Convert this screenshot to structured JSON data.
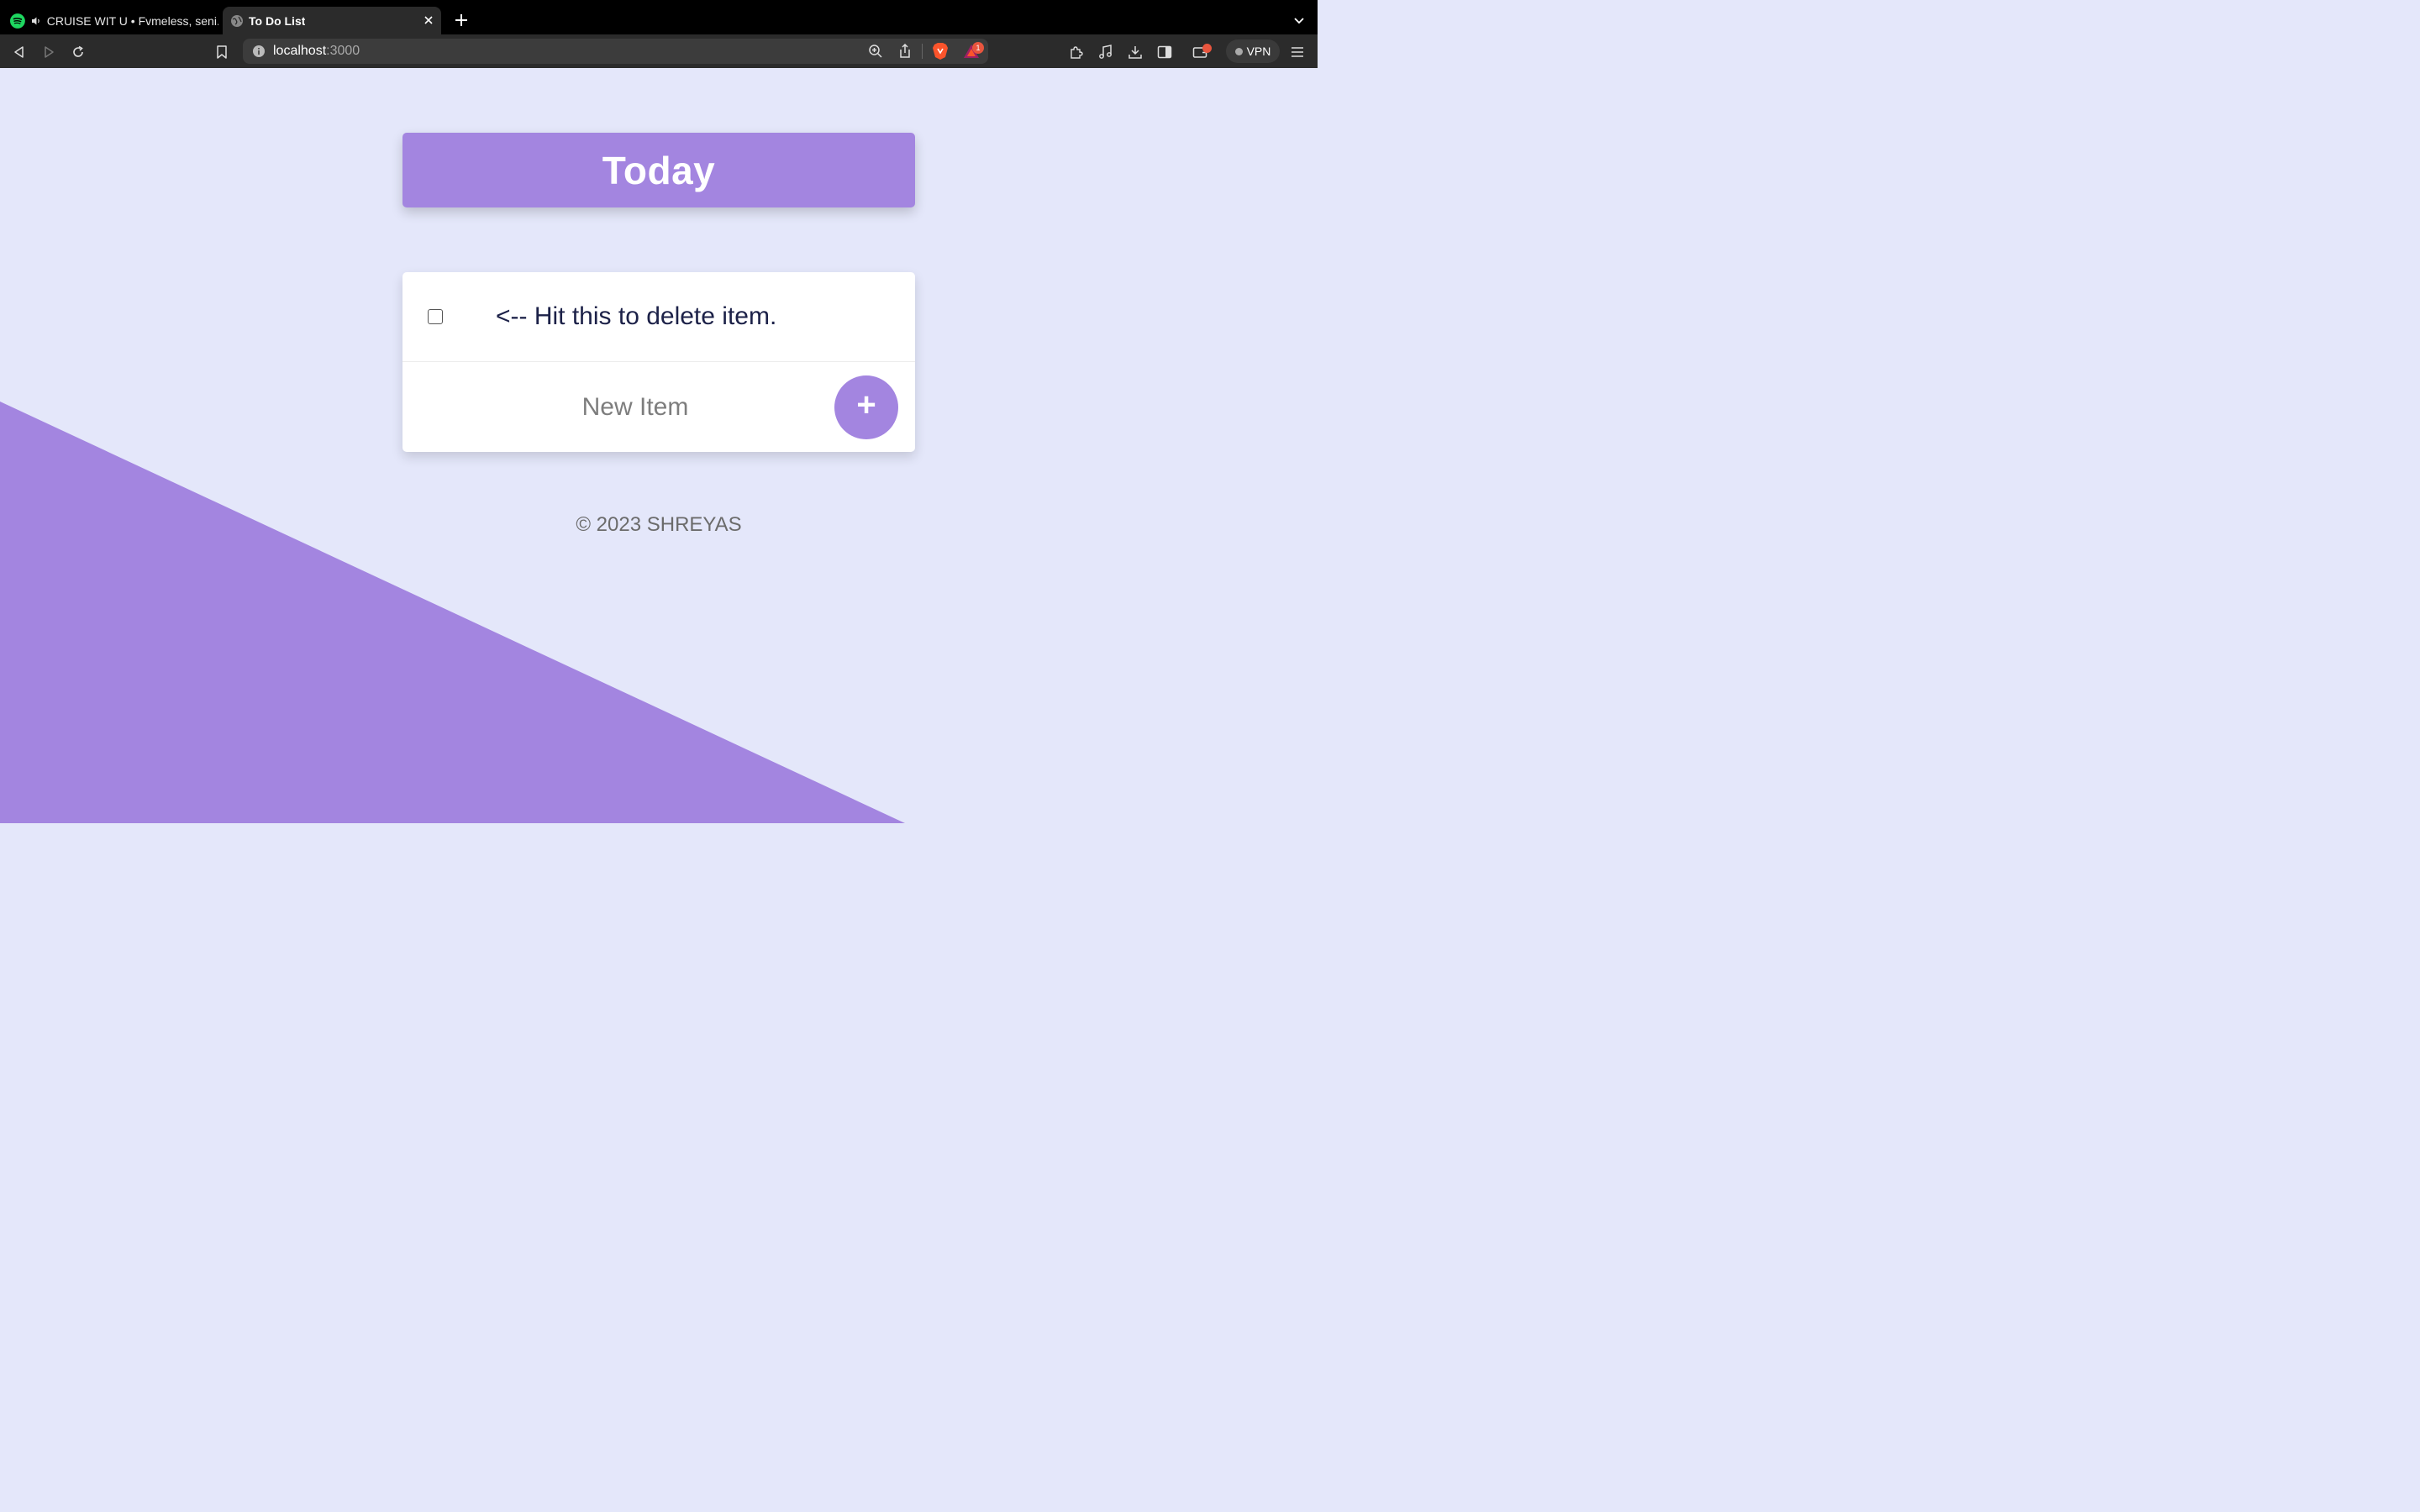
{
  "browser": {
    "tabs": [
      {
        "label": "CRUISE WIT U • Fvmeless, seni.",
        "active": false
      },
      {
        "label": "To Do List",
        "active": true
      }
    ],
    "url": {
      "host": "localhost",
      "port": ":3000"
    },
    "vpn_label": "VPN",
    "notification_count": "1",
    "icons": [
      "back-icon",
      "forward-icon",
      "reload-icon",
      "bookmark-icon",
      "site-info-icon",
      "zoom-icon",
      "share-icon",
      "brave-shield-icon",
      "brave-rewards-icon",
      "extensions-icon",
      "media-icon",
      "download-icon",
      "sidebar-icon",
      "wallet-icon",
      "menu-icon"
    ]
  },
  "page": {
    "heading": "Today",
    "items": [
      {
        "text": "<-- Hit this to delete item.",
        "checked": false
      }
    ],
    "new_item_placeholder": "New Item",
    "add_button_label": "+",
    "footer": "© 2023 SHREYAS",
    "colors": {
      "accent": "#a385e0",
      "background": "#e4e7fa",
      "card": "#ffffff",
      "item_text": "#1c2148"
    }
  }
}
